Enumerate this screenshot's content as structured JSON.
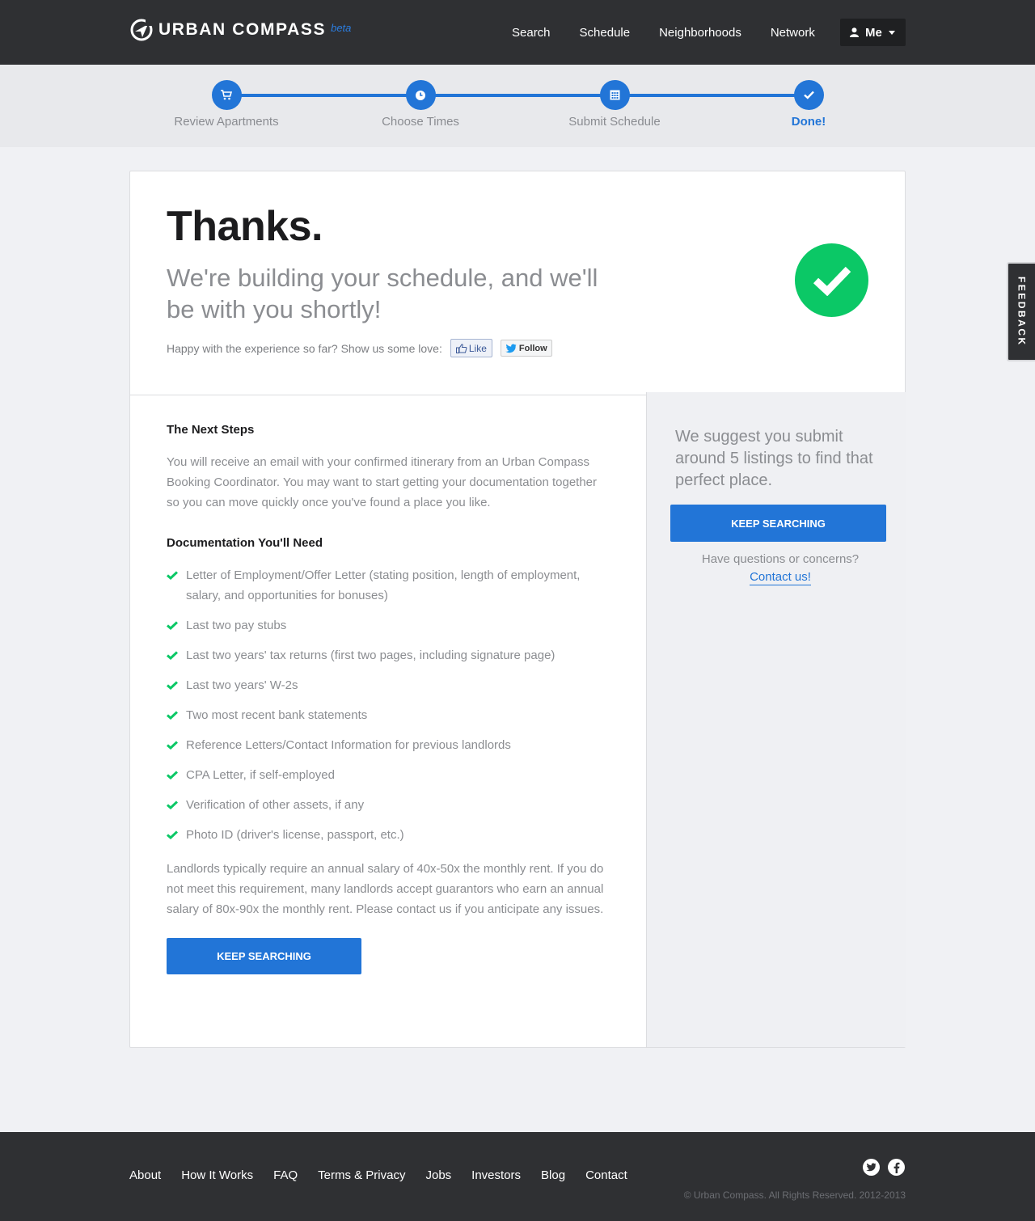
{
  "header": {
    "brand": "URBAN COMPASS",
    "beta": "beta",
    "nav": [
      "Search",
      "Schedule",
      "Neighborhoods",
      "Network"
    ],
    "user_menu": "Me"
  },
  "steps": [
    {
      "label": "Review Apartments",
      "icon": "cart-icon",
      "done": false
    },
    {
      "label": "Choose Times",
      "icon": "clock-icon",
      "done": false
    },
    {
      "label": "Submit Schedule",
      "icon": "calendar-icon",
      "done": false
    },
    {
      "label": "Done!",
      "icon": "check-icon",
      "done": true
    }
  ],
  "hero": {
    "title": "Thanks.",
    "subtitle": "We're building your schedule, and we'll be with you shortly!",
    "love_text": "Happy with the experience so far? Show us some love:",
    "like_label": "Like",
    "follow_label": "Follow"
  },
  "next_steps": {
    "title": "The Next Steps",
    "body": "You will receive an email with your confirmed itinerary from an Urban Compass Booking Coordinator. You may want to start getting your documentation together so you can move quickly once you've found a place you like."
  },
  "documentation": {
    "title": "Documentation You'll Need",
    "items": [
      "Letter of Employment/Offer Letter (stating position, length of employment, salary, and opportunities for bonuses)",
      "Last two pay stubs",
      "Last two years' tax returns (first two pages, including signature page)",
      "Last two years' W-2s",
      "Two most recent bank statements",
      "Reference Letters/Contact Information for previous landlords",
      "CPA Letter, if self-employed",
      "Verification of other assets, if any",
      "Photo ID (driver's license, passport, etc.)"
    ],
    "salary_note": "Landlords typically require an annual salary of 40x-50x the monthly rent. If you do not meet this requirement, many landlords accept guarantors who earn an annual salary of 80x-90x the monthly rent. Please contact us if you anticipate any issues.",
    "button": "KEEP SEARCHING"
  },
  "sidebar": {
    "suggestion": "We suggest you submit around 5 listings to find that perfect place.",
    "button": "KEEP SEARCHING",
    "questions": "Have questions or concerns?",
    "contact_link": "Contact us!"
  },
  "feedback": "FEEDBACK",
  "footer": {
    "links": [
      "About",
      "How It Works",
      "FAQ",
      "Terms & Privacy",
      "Jobs",
      "Investors",
      "Blog",
      "Contact"
    ],
    "copyright": "© Urban Compass. All Rights Reserved. 2012-2013"
  },
  "colors": {
    "accent": "#2275d7",
    "success": "#0bc866",
    "dark": "#2f3033"
  }
}
